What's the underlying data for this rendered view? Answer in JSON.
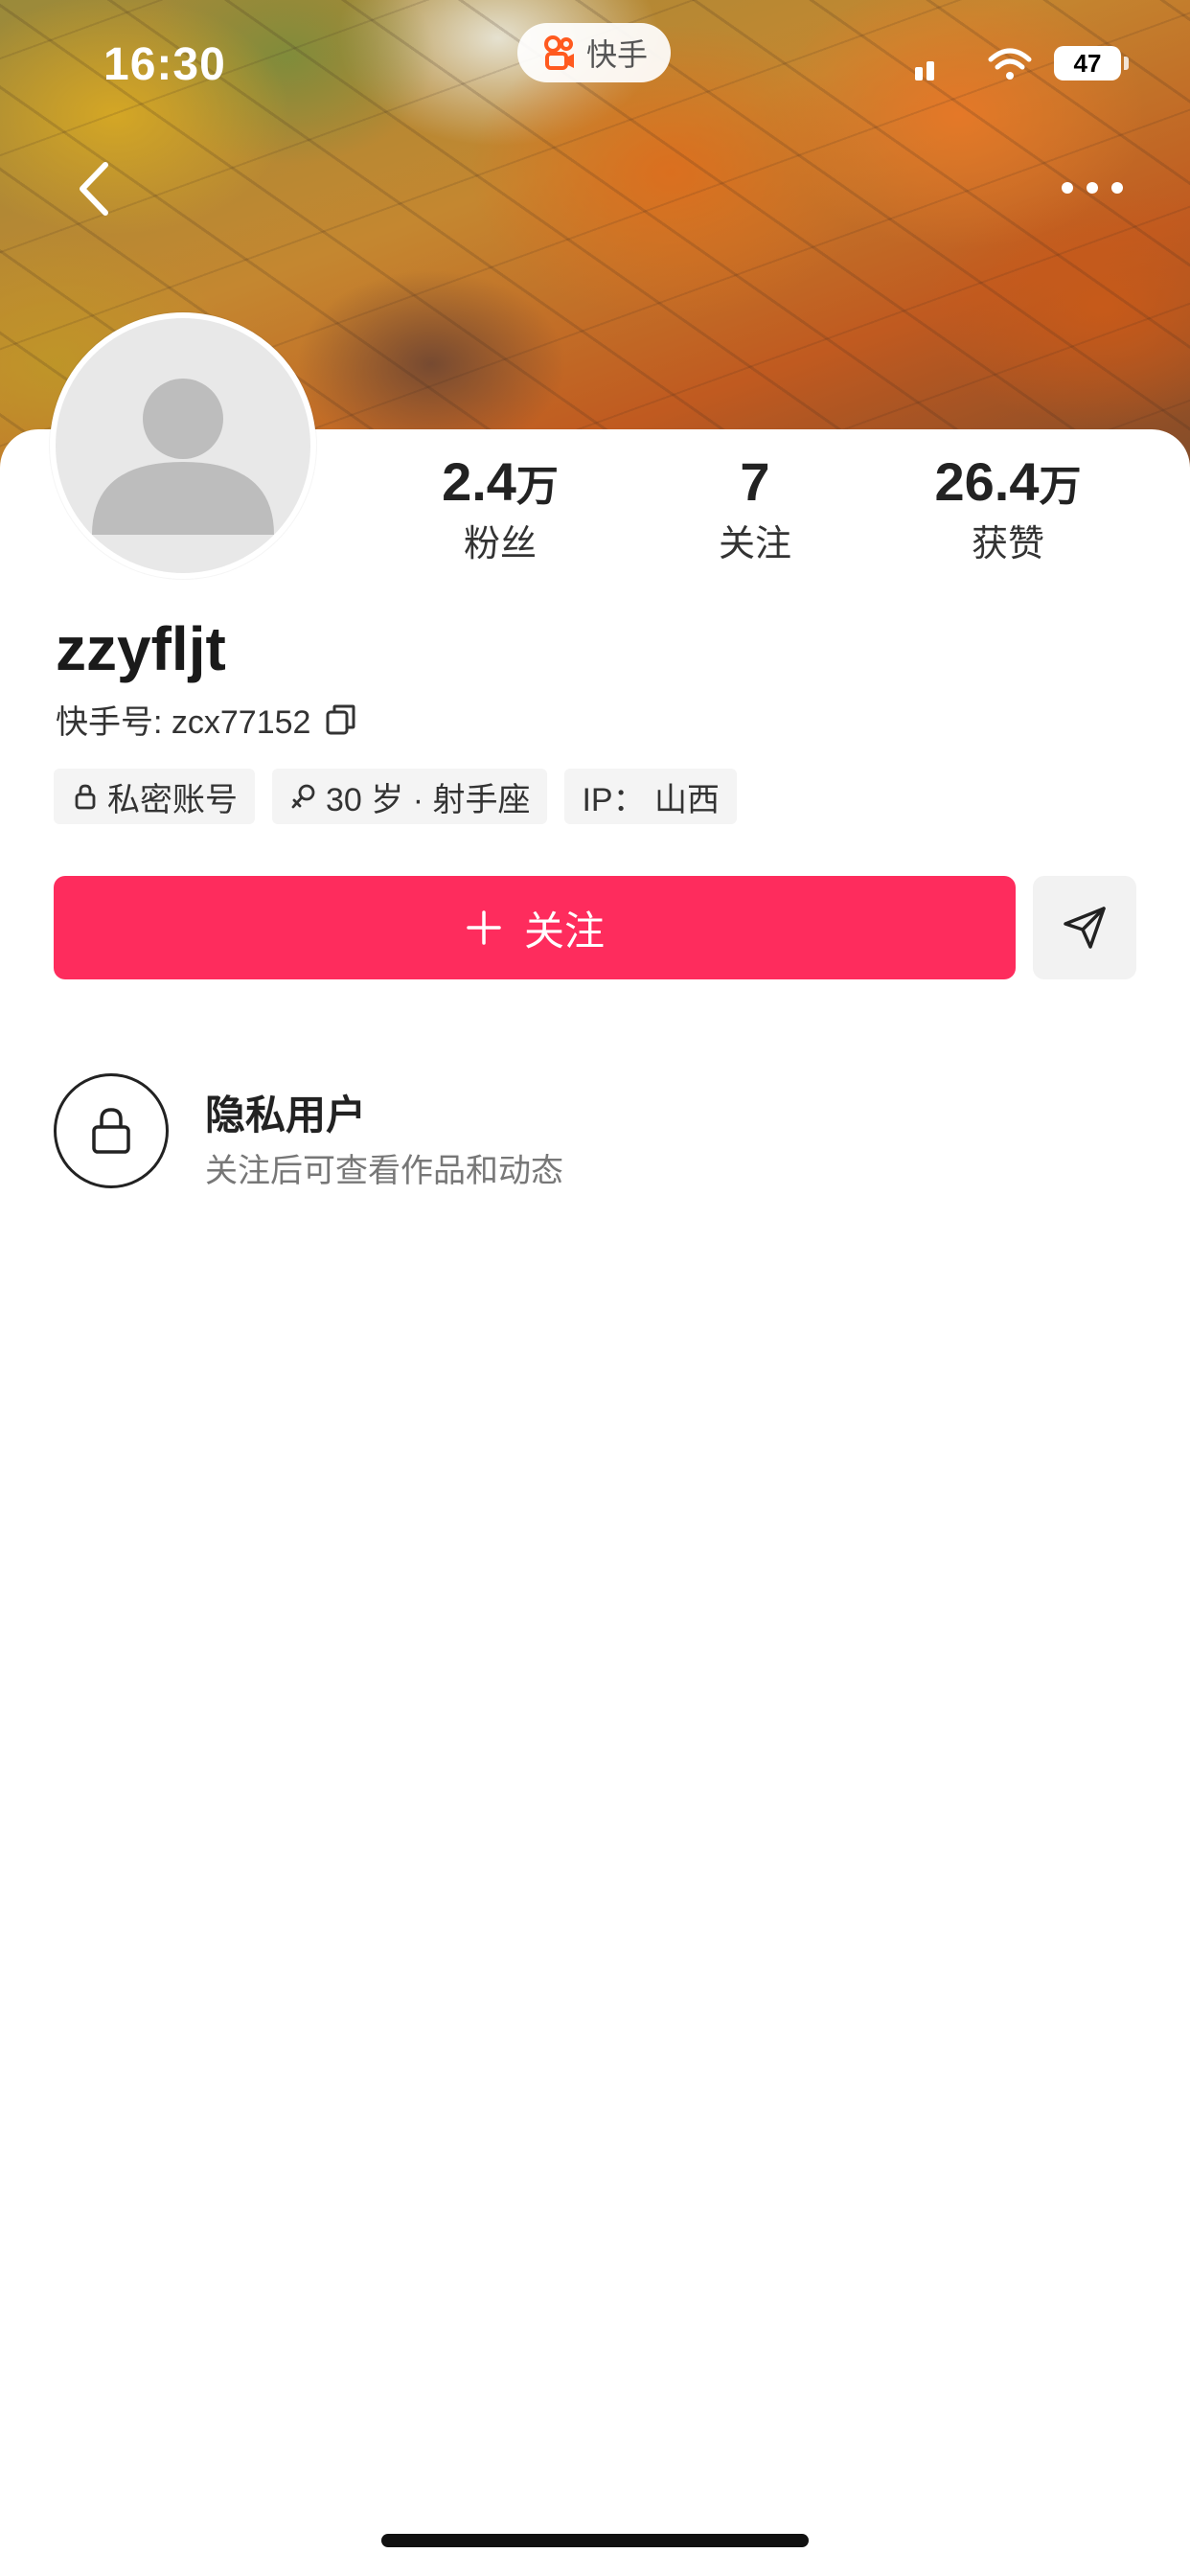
{
  "status_bar": {
    "time": "16:30",
    "app_name": "快手",
    "battery": "47"
  },
  "header": {
    "back_icon": "chevron-left-icon",
    "more_icon": "ellipsis-icon"
  },
  "profile": {
    "avatar_icon": "default-avatar-icon",
    "username": "zzyfljt",
    "user_id": "快手号: zcx77152",
    "stats": [
      {
        "value": "2.4",
        "unit": "万",
        "label": "粉丝"
      },
      {
        "value": "7",
        "unit": "",
        "label": "关注"
      },
      {
        "value": "26.4",
        "unit": "万",
        "label": "获赞"
      }
    ],
    "tags": [
      {
        "icon": "lock-icon",
        "text": "私密账号"
      },
      {
        "icon": "female-icon",
        "text": "30 岁 · 射手座"
      },
      {
        "icon": "",
        "text": "IP： 山西"
      }
    ]
  },
  "actions": {
    "follow_label": "关注",
    "follow_color": "#fe2c5d",
    "share_icon": "send-icon"
  },
  "private_notice": {
    "title": "隐私用户",
    "description": "关注后可查看作品和动态"
  }
}
